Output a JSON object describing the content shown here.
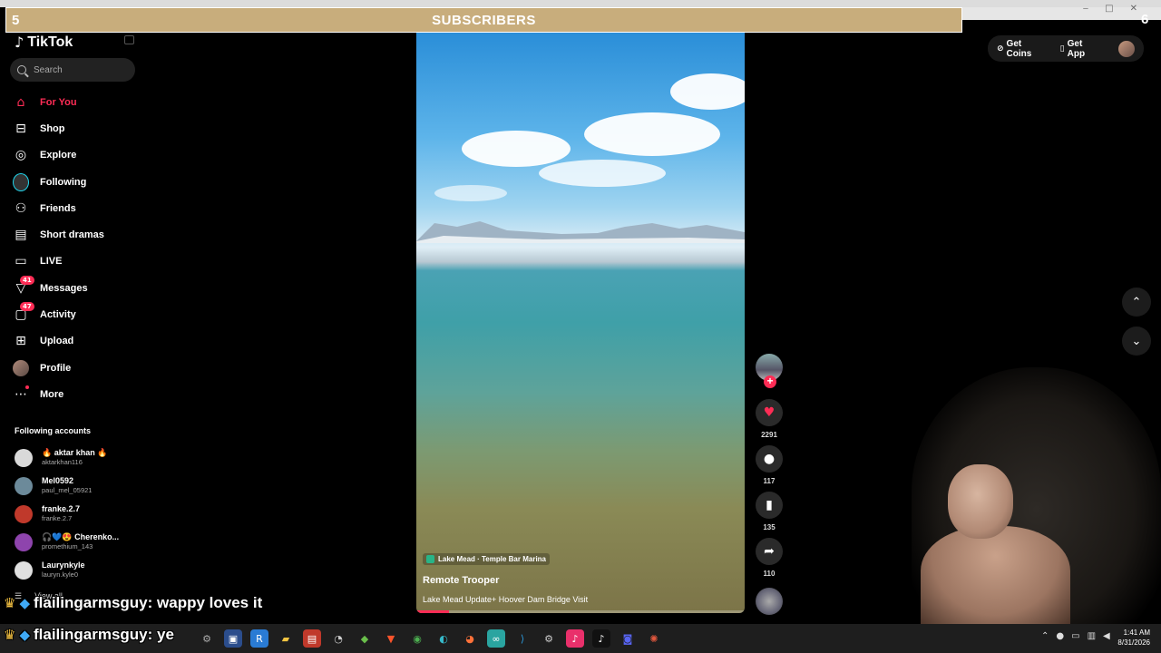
{
  "overlay": {
    "sub_left": "5",
    "sub_title": "SUBSCRIBERS",
    "sub_right": "6",
    "chat": [
      {
        "user": "flailingarmsguy",
        "text": "flailingarmsguy: wappy loves it"
      },
      {
        "user": "flailingarmsguy",
        "text": "flailingarmsguy: ye"
      }
    ]
  },
  "app": {
    "logo": "TikTok",
    "search_placeholder": "Search"
  },
  "nav": [
    {
      "label": "For You",
      "icon": "home-icon",
      "active": true
    },
    {
      "label": "Shop",
      "icon": "shop-icon"
    },
    {
      "label": "Explore",
      "icon": "compass-icon"
    },
    {
      "label": "Following",
      "icon": "following-icon"
    },
    {
      "label": "Friends",
      "icon": "friends-icon"
    },
    {
      "label": "Short dramas",
      "icon": "film-icon"
    },
    {
      "label": "LIVE",
      "icon": "live-icon"
    },
    {
      "label": "Messages",
      "icon": "send-icon",
      "badge": "41"
    },
    {
      "label": "Activity",
      "icon": "inbox-icon",
      "badge": "47"
    },
    {
      "label": "Upload",
      "icon": "upload-icon"
    },
    {
      "label": "Profile",
      "icon": "avatar"
    },
    {
      "label": "More",
      "icon": "more-icon"
    }
  ],
  "following": {
    "heading": "Following accounts",
    "accounts": [
      {
        "name": "🔥 aktar khan 🔥",
        "handle": "aktarkhan116",
        "color": "#d9d9d9"
      },
      {
        "name": "Mel0592",
        "handle": "paul_mel_05921",
        "color": "#6c8a9a"
      },
      {
        "name": "franke.2.7",
        "handle": "franke.2.7",
        "color": "#c0392b"
      },
      {
        "name": "🎧💙😍 Cherenko...",
        "handle": "promethium_143",
        "color": "#8e44ad"
      },
      {
        "name": "Laurynkyle",
        "handle": "lauryn.kyle0",
        "color": "#e0e0e0"
      }
    ],
    "view_all": "View all"
  },
  "video": {
    "location": "Lake Mead · Temple Bar Marina",
    "author": "Remote Trooper",
    "description": "Lake Mead Update+ Hoover Dam Bridge Visit",
    "progress": 0.1
  },
  "actions": {
    "likes": "2291",
    "comments": "117",
    "saves": "135",
    "shares": "110"
  },
  "topbar": {
    "coins": "Get Coins",
    "app": "Get App"
  },
  "clock": {
    "time": "1:41 AM",
    "date": "8/31/2026"
  },
  "colors": {
    "accent": "#fe2c55",
    "subscriber_bar": "#c8ad7c"
  }
}
